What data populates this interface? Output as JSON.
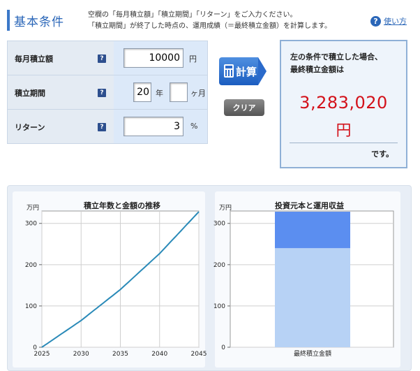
{
  "header": {
    "title": "基本条件",
    "description_line1": "空欄の「毎月積立額」「積立期間」「リターン」をご入力ください。",
    "description_line2": "「積立期間」が終了した時点の、運用成績（＝最終積立金額）を計算します。",
    "help_label": "使い方",
    "help_icon_glyph": "?"
  },
  "form": {
    "monthly": {
      "label": "毎月積立額",
      "value": "10000",
      "unit": "円"
    },
    "period": {
      "label": "積立期間",
      "years": "20",
      "years_unit": "年",
      "months": "",
      "months_unit": "ヶ月"
    },
    "return": {
      "label": "リターン",
      "value": "3",
      "unit": "%"
    },
    "help_glyph": "?"
  },
  "buttons": {
    "calc_label": "計算",
    "clear_label": "クリア"
  },
  "result": {
    "line1": "左の条件で積立した場合、",
    "line2": "最終積立金額は",
    "amount": "3,283,020",
    "unit": "円",
    "suffix": "です。"
  },
  "colors": {
    "accent": "#2a66b8",
    "result_red": "#d3111a",
    "line": "#2a8ab8",
    "bar_principal": "#b7d2f5",
    "bar_gain": "#5b8ef0"
  },
  "chart_data": [
    {
      "type": "line",
      "title": "積立年数と金額の推移",
      "ylabel": "万円",
      "x": [
        2025,
        2030,
        2035,
        2040,
        2045
      ],
      "x_ticks": [
        "2025",
        "2030",
        "2035",
        "2040",
        "2045"
      ],
      "y_ticks": [
        "0",
        "100",
        "200",
        "300"
      ],
      "ylim": [
        0,
        330
      ],
      "series": [
        {
          "values": [
            0,
            64.8,
            139.8,
            226.9,
            328.3
          ]
        }
      ],
      "grid": true
    },
    {
      "type": "bar",
      "title": "投資元本と運用収益",
      "ylabel": "万円",
      "categories": [
        "最終積立金額"
      ],
      "y_ticks": [
        "0",
        "100",
        "200",
        "300"
      ],
      "ylim": [
        0,
        330
      ],
      "series": [
        {
          "values": [
            240
          ]
        },
        {
          "values": [
            88.3
          ]
        }
      ],
      "stacked": true,
      "grid": true
    }
  ]
}
